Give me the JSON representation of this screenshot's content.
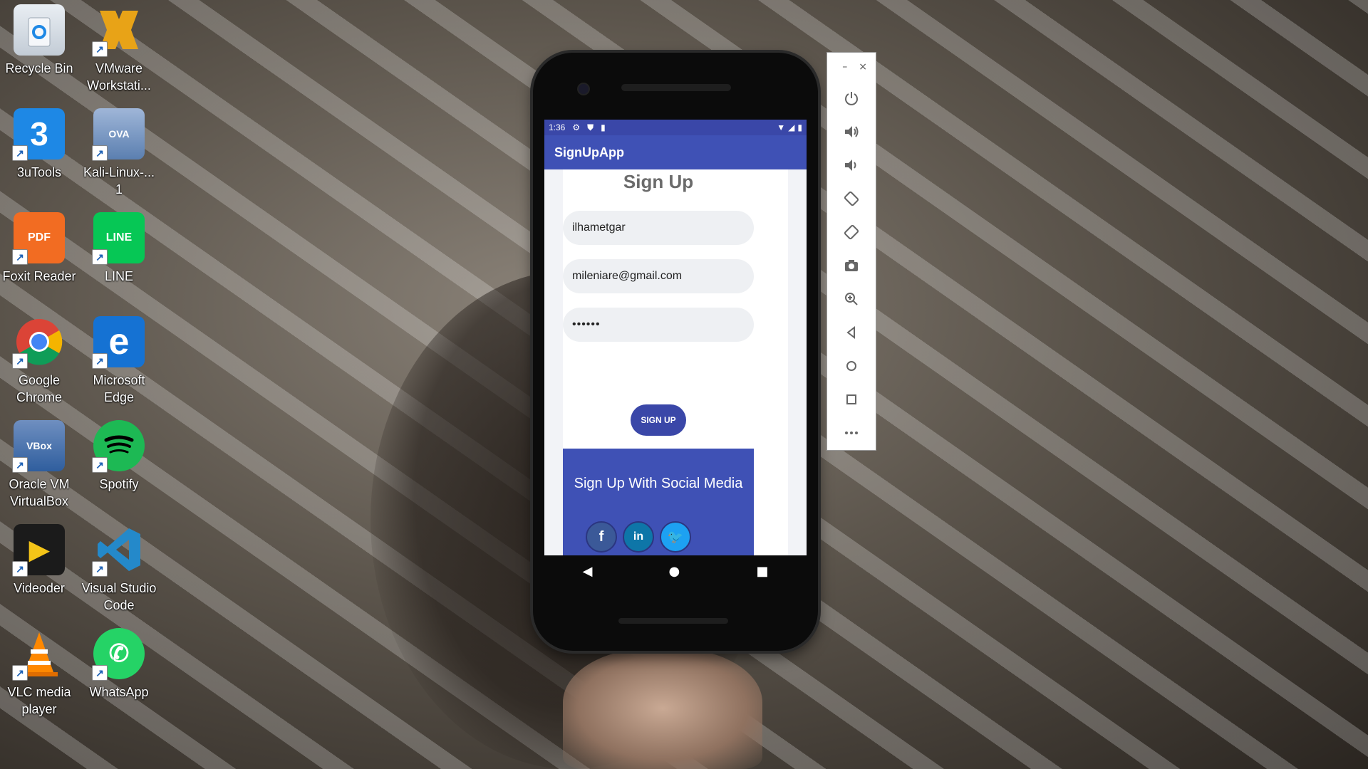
{
  "desktop": {
    "icons": [
      {
        "label": "Recycle Bin",
        "icon": "recycle-bin-icon",
        "color": "#dfe6ee"
      },
      {
        "label": "VMware Workstati...",
        "icon": "vmware-icon",
        "color": "#e8a317"
      },
      {
        "label": "3uTools",
        "icon": "3utools-icon",
        "color": "#1e88e5"
      },
      {
        "label": "Kali-Linux-... 1",
        "icon": "virtualbox-ova-icon",
        "color": "#5b7fb0"
      },
      {
        "label": "Foxit Reader",
        "icon": "foxit-reader-icon",
        "color": "#f26c22"
      },
      {
        "label": "LINE",
        "icon": "line-icon",
        "color": "#06c755"
      },
      {
        "label": "Google Chrome",
        "icon": "chrome-icon",
        "color": "#4285f4"
      },
      {
        "label": "Microsoft Edge",
        "icon": "edge-icon",
        "color": "#1572d3"
      },
      {
        "label": "Oracle VM VirtualBox",
        "icon": "virtualbox-icon",
        "color": "#2f5e9e"
      },
      {
        "label": "Spotify",
        "icon": "spotify-icon",
        "color": "#1db954"
      },
      {
        "label": "Videoder",
        "icon": "videoder-icon",
        "color": "#1b1b1b"
      },
      {
        "label": "Visual Studio Code",
        "icon": "vscode-icon",
        "color": "#2489ca"
      },
      {
        "label": "VLC media player",
        "icon": "vlc-icon",
        "color": "#ff8800"
      },
      {
        "label": "WhatsApp",
        "icon": "whatsapp-icon",
        "color": "#25d366"
      }
    ]
  },
  "phone": {
    "status": {
      "time": "1:36"
    },
    "app_title": "SignUpApp",
    "form": {
      "title": "Sign Up",
      "username_value": "ilhametgar",
      "email_value": "mileniare@gmail.com",
      "password_value": "••••••",
      "signup_label": "SIGN UP"
    },
    "social": {
      "title": "Sign Up With Social Media",
      "facebook": "f",
      "linkedin": "in",
      "twitter": "🐦"
    },
    "nav": {
      "back": "◀",
      "home": "●",
      "recents": "■"
    }
  },
  "emulator_toolbar": {
    "minimize": "–",
    "close": "×",
    "buttons": [
      "power-icon",
      "volume-up-icon",
      "volume-down-icon",
      "rotate-left-icon",
      "rotate-right-icon",
      "camera-icon",
      "zoom-icon",
      "back-icon",
      "home-icon",
      "overview-icon",
      "more-icon"
    ]
  },
  "colors": {
    "app_primary": "#3f51b5",
    "status_bar": "#3a47a8",
    "facebook": "#3b5998",
    "linkedin": "#0e76a8",
    "twitter": "#1da1f2"
  }
}
